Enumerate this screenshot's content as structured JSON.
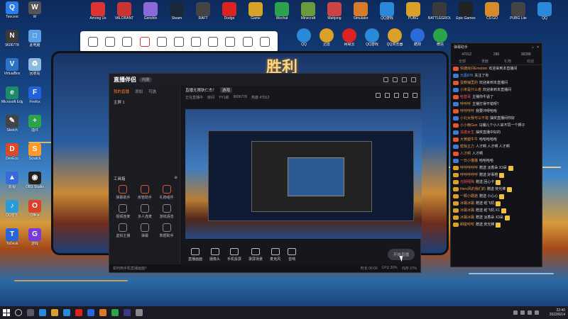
{
  "desktop": {
    "left_icons": [
      {
        "label": "Tencent",
        "color": "#2b7de9",
        "glyph": "Q"
      },
      {
        "label": "W",
        "color": "#555",
        "glyph": "W"
      },
      {
        "label": "9606778",
        "color": "#3a3a3a",
        "glyph": "N"
      },
      {
        "label": "此电脑",
        "color": "#5aa0e6",
        "glyph": "□"
      },
      {
        "label": "VirtualBox",
        "color": "#2c73c7",
        "glyph": "V"
      },
      {
        "label": "回收站",
        "color": "#8bb8de",
        "glyph": "♻"
      },
      {
        "label": "Microsoft Edge",
        "color": "#1d8a6a",
        "glyph": "e"
      },
      {
        "label": "Firefox",
        "color": "#2361d8",
        "glyph": "F"
      },
      {
        "label": "Sketch",
        "color": "#444",
        "glyph": "✎"
      },
      {
        "label": "插件",
        "color": "#2aa34a",
        "glyph": "+"
      },
      {
        "label": "DevEco",
        "color": "#d94a2a",
        "glyph": "D"
      },
      {
        "label": "Scratch",
        "color": "#ff9a2a",
        "glyph": "S"
      },
      {
        "label": "影视",
        "color": "#3a6ad9",
        "glyph": "▲"
      },
      {
        "label": "OBS Studio",
        "color": "#222",
        "glyph": "◉"
      },
      {
        "label": "QQ音乐",
        "color": "#2a9ad9",
        "glyph": "♪"
      },
      {
        "label": "Office",
        "color": "#d9422a",
        "glyph": "O"
      },
      {
        "label": "ToDesk",
        "color": "#2a64d9",
        "glyph": "T"
      },
      {
        "label": "游戏",
        "color": "#7a3ad9",
        "glyph": "G"
      }
    ],
    "top_icons": [
      {
        "label": "Among Us",
        "color": "#d33"
      },
      {
        "label": "VALORANT",
        "color": "#c33"
      },
      {
        "label": "Genshin",
        "color": "#8a6ad9"
      },
      {
        "label": "Steam",
        "color": "#1b2838"
      },
      {
        "label": "RAFT",
        "color": "#444"
      },
      {
        "label": "Dodge",
        "color": "#d22"
      },
      {
        "label": "Game",
        "color": "#d9a12a"
      },
      {
        "label": "Wechat",
        "color": "#2aa34a"
      },
      {
        "label": "Minecraft",
        "color": "#6a9a3a"
      },
      {
        "label": "Mahjong",
        "color": "#c44"
      },
      {
        "label": "Simulator",
        "color": "#d97a2a"
      },
      {
        "label": "QQ游戏",
        "color": "#2a8ad9"
      },
      {
        "label": "PUBG",
        "color": "#d9a12a"
      },
      {
        "label": "BATTLEGROUNDS",
        "color": "#3a3a3a"
      },
      {
        "label": "Epic Games",
        "color": "#222"
      },
      {
        "label": "CS:GO",
        "color": "#d98a2a"
      },
      {
        "label": "PUBG Lite",
        "color": "#444"
      },
      {
        "label": "QQ",
        "color": "#2a8ad9"
      }
    ],
    "second_row": [
      {
        "label": "QQ",
        "color": "#2a8ad9"
      },
      {
        "label": "迅雷",
        "color": "#d9a12a"
      },
      {
        "label": "网易云",
        "color": "#d22"
      },
      {
        "label": "QQ游戏",
        "color": "#2a8ad9"
      },
      {
        "label": "QQ浏览器",
        "color": "#d9a12a"
      },
      {
        "label": "酷狗",
        "color": "#2a6ad9"
      },
      {
        "label": "微信",
        "color": "#2aa34a"
      }
    ]
  },
  "toolbar": {
    "buttons": [
      "selection-tool",
      "crop-tool",
      "camera-tool",
      "record-tool",
      "screen-tool",
      "pin-tool",
      "region-tool",
      "rect-tool",
      "settings-tool",
      "headset-tool",
      "cart-tool"
    ]
  },
  "monitor": {
    "banner": "胜利"
  },
  "app": {
    "logo": "直播伴侣",
    "version": "内测",
    "left_tabs": [
      "我的直播",
      "添加",
      "可选"
    ],
    "scene": "主屏 1",
    "tools_title": "工具箱",
    "tools": [
      "弹幕助手",
      "房管助手",
      "礼物组件",
      "视频连麦",
      "多人连麦",
      "游戏语音",
      "虚拟主播",
      "弹幕",
      "数据助手"
    ],
    "room_title": "直播无限狄仁杰！",
    "room_tag": "游戏",
    "room_meta": [
      "正在直播中",
      "房间",
      "YY1房",
      "9606778",
      "热度 47012"
    ],
    "bottom": [
      "直播画面",
      "摄像头",
      "手机投屏",
      "录屏场景",
      "麦克风",
      "音响"
    ],
    "start_live": "开始直播",
    "status_left": "如何用手机直播画面？",
    "status_right": [
      "时长 00:00",
      "CPU 30%",
      "内存 37%"
    ]
  },
  "chat": {
    "title": "弹幕助手",
    "stats": [
      "47012",
      "286",
      "38288"
    ],
    "tabs": [
      "全部",
      "贡献",
      "礼物",
      "欢迎"
    ],
    "messages": [
      {
        "badge": "主",
        "user": "快捷房间Emotion",
        "text": "欢迎来到本直播间",
        "color": "orange"
      },
      {
        "badge": "",
        "user": "元嘉876",
        "text": "关注了你",
        "color": "blue"
      },
      {
        "badge": "主",
        "user": "蛋糕铺里的",
        "text": "欢迎来到本直播间",
        "color": "orange"
      },
      {
        "badge": "",
        "user": "小米是什么者",
        "text": "欢迎来到本直播间",
        "color": "orange"
      },
      {
        "badge": "主",
        "user": "哈登哥",
        "text": "主播你牛逼了",
        "color": "red"
      },
      {
        "badge": "",
        "user": "呼呼呼",
        "text": "主播打得不错呀？",
        "color": "orange"
      },
      {
        "badge": "主",
        "user": "呼呼呼呼",
        "text": "我要冲呀哈哈",
        "color": "orange"
      },
      {
        "badge": "",
        "user": "小北女我可以不错",
        "text": "抽奖直播间你好",
        "color": "orange"
      },
      {
        "badge": "主",
        "user": "小小晚Gun",
        "text": "马桶儿个小人来不同一个狮子",
        "color": "orange"
      },
      {
        "badge": "",
        "user": "清澈女生",
        "text": "抽奖直播中好的",
        "color": "red"
      },
      {
        "badge": "主",
        "user": "大黄腿牛牛",
        "text": "哈哈哈哈哈",
        "color": "orange"
      },
      {
        "badge": "",
        "user": "帮我主力",
        "text": "人才啊 人才啊 人才啊",
        "color": "orange"
      },
      {
        "badge": "主",
        "user": "人才啊",
        "text": "人才啊",
        "color": "orange"
      },
      {
        "badge": "",
        "user": "一日小猫猫",
        "text": "哈哈哈哈",
        "color": "orange"
      },
      {
        "badge": "g",
        "user": "呼呼呼呼呼",
        "text": "赠送 淡香朵 X3朵",
        "color": "orange"
      },
      {
        "badge": "g",
        "user": "呼呼呼呼呼",
        "text": "赠送 好事橙",
        "color": "orange"
      },
      {
        "badge": "g",
        "user": "光阴残殇",
        "text": "赠送 回心卡",
        "color": "red"
      },
      {
        "badge": "g",
        "user": "Hero风的我们的",
        "text": "赠送 荧光棒",
        "color": "orange"
      },
      {
        "badge": "g",
        "user": "一颗小蘑菇",
        "text": "赠送 小心心",
        "color": "orange"
      },
      {
        "badge": "g",
        "user": "冰霜冰霜",
        "text": "赠送 纸飞机",
        "color": "orange"
      },
      {
        "badge": "g",
        "user": "冰霜冰霜",
        "text": "赠送 纸飞机 X1",
        "color": "orange"
      },
      {
        "badge": "g",
        "user": "冰霜冰霜",
        "text": "赠送 淡香朵 X3朵",
        "color": "orange"
      },
      {
        "badge": "g",
        "user": "刷碰咬咬",
        "text": "赠送 荧光棒",
        "color": "orange"
      }
    ]
  },
  "taskbar": {
    "time": "22:40",
    "date": "2022/6/14"
  }
}
